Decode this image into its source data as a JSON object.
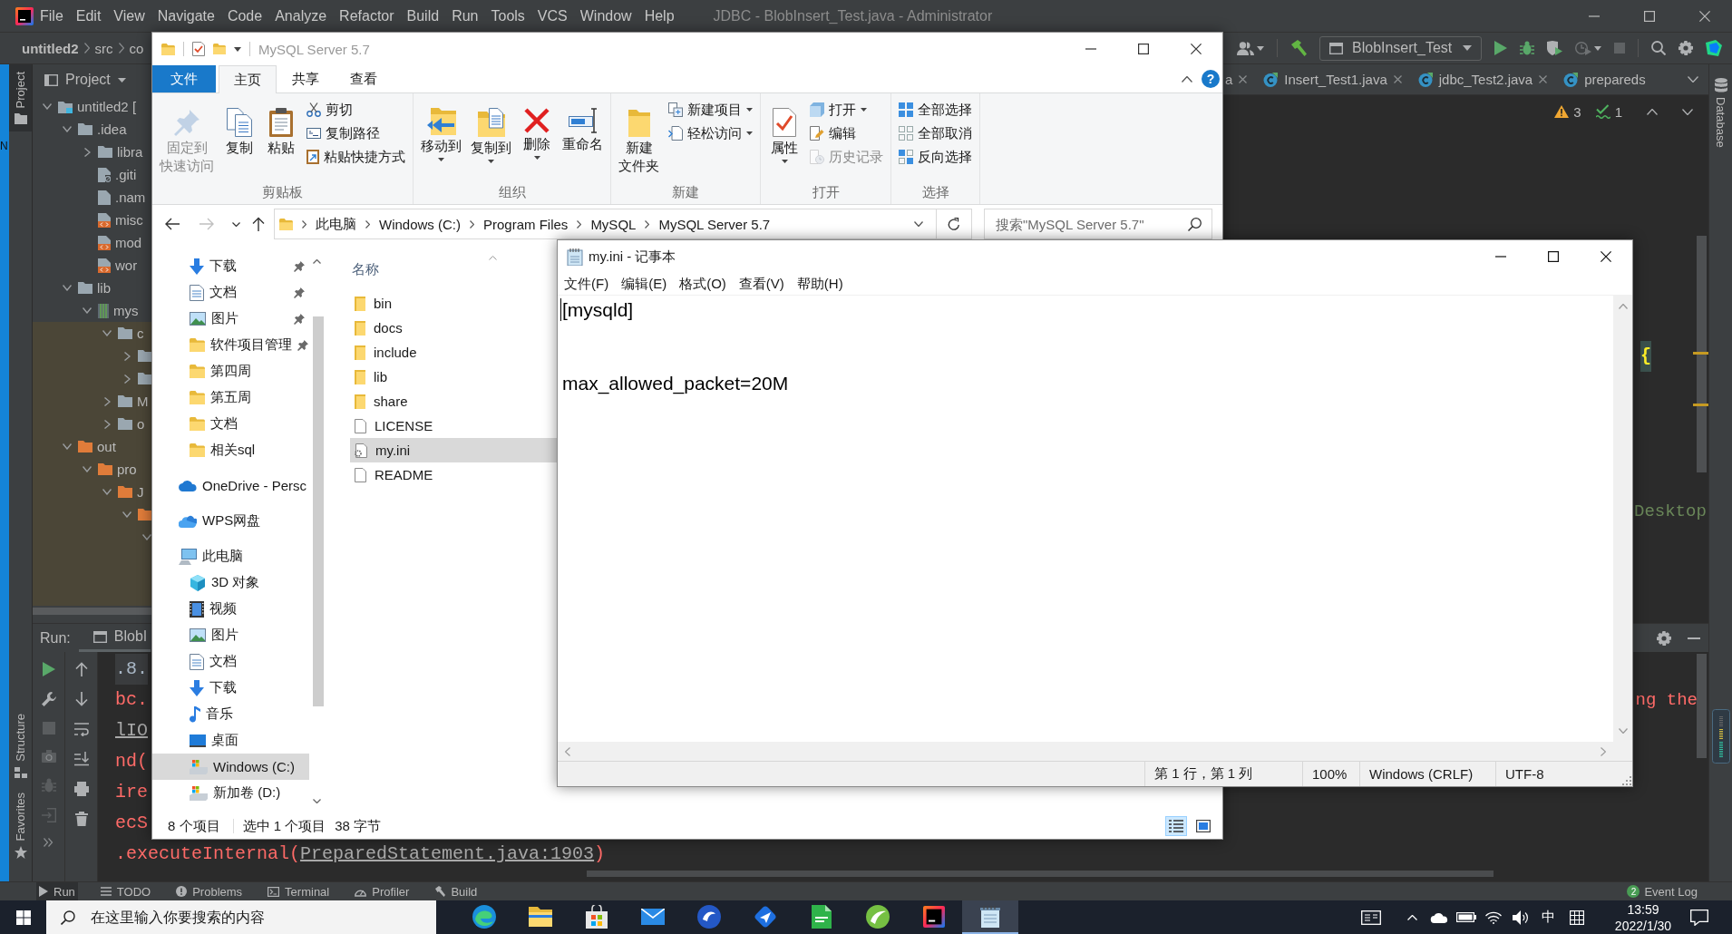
{
  "desktop": {
    "edge_text": "N"
  },
  "ide": {
    "menu": [
      "File",
      "Edit",
      "View",
      "Navigate",
      "Code",
      "Analyze",
      "Refactor",
      "Build",
      "Run",
      "Tools",
      "VCS",
      "Window",
      "Help"
    ],
    "title": "JDBC - BlobInsert_Test.java - Administrator",
    "breadcrumb": [
      "untitled2",
      "src",
      "co"
    ],
    "run_config": "BlobInsert_Test",
    "left_tool_tabs": [
      {
        "label": "Project",
        "selected": true
      },
      {
        "label": "Structure",
        "selected": false
      },
      {
        "label": "Favorites",
        "selected": false
      }
    ],
    "project_panel": {
      "title": "Project",
      "tree": [
        {
          "label": "untitled2 [",
          "kind": "module",
          "expanded": true,
          "tinted": false,
          "children": [
            {
              "label": ".idea",
              "kind": "folder",
              "expanded": true,
              "tinted": false,
              "children": [
                {
                  "label": "libra",
                  "kind": "folder",
                  "expanded": false,
                  "tinted": false
                },
                {
                  "label": ".giti",
                  "kind": "ignore",
                  "tinted": false
                },
                {
                  "label": ".nam",
                  "kind": "text",
                  "tinted": false
                },
                {
                  "label": "misc",
                  "kind": "xml",
                  "tinted": false
                },
                {
                  "label": "mod",
                  "kind": "xml",
                  "tinted": false
                },
                {
                  "label": "wor",
                  "kind": "xml",
                  "tinted": false
                }
              ]
            },
            {
              "label": "lib",
              "kind": "folder",
              "expanded": true,
              "tinted": false,
              "children": [
                {
                  "label": "mys",
                  "kind": "jar",
                  "expanded": true,
                  "tinted": false,
                  "children": [
                    {
                      "label": "c",
                      "kind": "folder",
                      "expanded": true,
                      "tinted": true,
                      "children": [
                        {
                          "kind": "folder",
                          "expanded": false,
                          "tinted": true
                        },
                        {
                          "kind": "folder",
                          "expanded": false,
                          "tinted": true
                        }
                      ]
                    },
                    {
                      "label": "M",
                      "kind": "folder",
                      "expanded": false,
                      "tinted": true
                    },
                    {
                      "label": "o",
                      "kind": "folder",
                      "expanded": false,
                      "tinted": true
                    }
                  ]
                }
              ]
            },
            {
              "label": "out",
              "kind": "excluded",
              "expanded": true,
              "tinted": true,
              "children": [
                {
                  "label": "pro",
                  "kind": "excluded",
                  "expanded": true,
                  "tinted": true,
                  "children": [
                    {
                      "label": "J",
                      "kind": "excluded",
                      "expanded": true,
                      "tinted": true,
                      "children": [
                        {
                          "kind": "excluded",
                          "expanded": true,
                          "tinted": true,
                          "children": [
                            {
                              "expanded": true,
                              "tinted": true
                            }
                          ]
                        }
                      ]
                    }
                  ]
                }
              ]
            }
          ]
        }
      ]
    },
    "editor_tabs": [
      {
        "label": "a",
        "kind": "tail"
      },
      {
        "label": "Insert_Test1.java",
        "kind": "full"
      },
      {
        "label": "jdbc_Test2.java",
        "kind": "full"
      },
      {
        "label": "prepareds",
        "kind": "head"
      }
    ],
    "inspections": {
      "warnings": "3",
      "weak_warnings": "1"
    },
    "editor": {
      "brace": "{",
      "string_fragment": "Desktop"
    },
    "run_panel": {
      "label": "Run:",
      "tab": "BlobI",
      "lines": [
        {
          "text": ".8.",
          "kind": "highlight"
        },
        {
          "text": "bc.",
          "kind": "error",
          "tail": "ng the"
        },
        {
          "text": "lIO",
          "kind": "link"
        },
        {
          "text": "nd(",
          "kind": "error"
        },
        {
          "text": "ire",
          "kind": "error"
        },
        {
          "text": "ecS",
          "kind": "error"
        }
      ],
      "trace": {
        "prefix": ".executeInternal(",
        "link": "PreparedStatement.java:1903",
        "suffix": ")"
      }
    },
    "bottom_tools": [
      {
        "label": "Run",
        "selected": true
      },
      {
        "label": "TODO",
        "selected": false
      },
      {
        "label": "Problems",
        "selected": false
      },
      {
        "label": "Terminal",
        "selected": false
      },
      {
        "label": "Profiler",
        "selected": false
      },
      {
        "label": "Build",
        "selected": false
      }
    ],
    "event_log": {
      "count": "2",
      "label": "Event Log"
    },
    "right_tool_tabs": [
      "Database"
    ]
  },
  "explorer": {
    "title": "MySQL Server 5.7",
    "file_menu": "文件",
    "help": "?",
    "ribbon_tabs": [
      {
        "label": "主页",
        "selected": true
      },
      {
        "label": "共享",
        "selected": false
      },
      {
        "label": "查看",
        "selected": false
      }
    ],
    "ribbon_groups": [
      {
        "label": "剪贴板",
        "buttons": [
          {
            "kind": "large",
            "lines": [
              "固定到",
              "快速访问"
            ],
            "disabled": true,
            "dropdown": false
          },
          {
            "kind": "large",
            "lines": [
              "复制"
            ],
            "disabled": false,
            "dropdown": false
          },
          {
            "kind": "large",
            "lines": [
              "粘贴"
            ],
            "disabled": false,
            "dropdown": false
          },
          {
            "kind": "small",
            "lines": [
              "剪切"
            ],
            "disabled": false,
            "dropdown": false
          },
          {
            "kind": "small",
            "lines": [
              "复制路径"
            ],
            "disabled": false,
            "dropdown": false
          },
          {
            "kind": "small",
            "lines": [
              "粘贴快捷方式"
            ],
            "disabled": false,
            "dropdown": false
          }
        ]
      },
      {
        "label": "组织",
        "buttons": [
          {
            "kind": "large",
            "lines": [
              "移动到"
            ],
            "disabled": false,
            "dropdown": true
          },
          {
            "kind": "large",
            "lines": [
              "复制到"
            ],
            "disabled": false,
            "dropdown": true
          },
          {
            "kind": "large",
            "lines": [
              "删除"
            ],
            "disabled": false,
            "dropdown": true
          },
          {
            "kind": "large",
            "lines": [
              "重命名"
            ],
            "disabled": false,
            "dropdown": false
          }
        ]
      },
      {
        "label": "新建",
        "buttons": [
          {
            "kind": "large",
            "lines": [
              "新建",
              "文件夹"
            ],
            "disabled": false,
            "dropdown": false
          },
          {
            "kind": "small",
            "lines": [
              "新建项目"
            ],
            "disabled": false,
            "dropdown": true
          },
          {
            "kind": "small",
            "lines": [
              "轻松访问"
            ],
            "disabled": false,
            "dropdown": true
          }
        ]
      },
      {
        "label": "打开",
        "buttons": [
          {
            "kind": "large",
            "lines": [
              "属性"
            ],
            "disabled": false,
            "dropdown": true
          },
          {
            "kind": "small",
            "lines": [
              "打开"
            ],
            "disabled": false,
            "dropdown": true
          },
          {
            "kind": "small",
            "lines": [
              "编辑"
            ],
            "disabled": false,
            "dropdown": false
          },
          {
            "kind": "small",
            "lines": [
              "历史记录"
            ],
            "disabled": true,
            "dropdown": false
          }
        ]
      },
      {
        "label": "选择",
        "buttons": [
          {
            "kind": "small",
            "lines": [
              "全部选择"
            ],
            "disabled": false,
            "dropdown": false
          },
          {
            "kind": "small",
            "lines": [
              "全部取消"
            ],
            "disabled": false,
            "dropdown": false
          },
          {
            "kind": "small",
            "lines": [
              "反向选择"
            ],
            "disabled": false,
            "dropdown": false
          }
        ]
      }
    ],
    "nav_buttons": [
      {
        "disabled": false
      },
      {
        "disabled": true
      },
      {
        "disabled": false
      },
      {
        "disabled": false
      }
    ],
    "address": [
      "此电脑",
      "Windows (C:)",
      "Program Files",
      "MySQL",
      "MySQL Server 5.7"
    ],
    "search_placeholder": "搜索\"MySQL Server 5.7\"",
    "nav_pane": {
      "quick_access": [
        {
          "label": "下载",
          "kind": "downloads",
          "pinned": true,
          "selected": false
        },
        {
          "label": "文档",
          "kind": "documents",
          "pinned": true,
          "selected": false
        },
        {
          "label": "图片",
          "kind": "pictures",
          "pinned": true,
          "selected": false
        },
        {
          "label": "软件项目管理",
          "kind": "folder",
          "pinned": true,
          "selected": false
        },
        {
          "label": "第四周",
          "kind": "folder",
          "pinned": false,
          "selected": false
        },
        {
          "label": "第五周",
          "kind": "folder",
          "pinned": false,
          "selected": false
        },
        {
          "label": "文档",
          "kind": "folder",
          "pinned": false,
          "selected": false
        },
        {
          "label": "相关sql",
          "kind": "folder",
          "pinned": false,
          "selected": false
        }
      ],
      "locations": [
        {
          "label": "OneDrive - Persc",
          "kind": "onedrive",
          "selected": false
        },
        {
          "label": "WPS网盘",
          "kind": "cloud",
          "selected": false
        },
        {
          "label": "此电脑",
          "kind": "computer",
          "selected": false,
          "children": [
            {
              "label": "3D 对象",
              "kind": "objects3d",
              "selected": false
            },
            {
              "label": "视频",
              "kind": "videos",
              "selected": false
            },
            {
              "label": "图片",
              "kind": "pictures",
              "selected": false
            },
            {
              "label": "文档",
              "kind": "documents",
              "selected": false
            },
            {
              "label": "下载",
              "kind": "downloads",
              "selected": false
            },
            {
              "label": "音乐",
              "kind": "music",
              "selected": false
            },
            {
              "label": "桌面",
              "kind": "desktop",
              "selected": false
            },
            {
              "label": "Windows (C:)",
              "kind": "drive",
              "selected": true
            },
            {
              "label": "新加卷 (D:)",
              "kind": "drive",
              "selected": false
            }
          ]
        }
      ]
    },
    "file_list": {
      "column": "名称",
      "rows": [
        {
          "name": "bin",
          "kind": "folder",
          "selected": false
        },
        {
          "name": "docs",
          "kind": "folder",
          "selected": false
        },
        {
          "name": "include",
          "kind": "folder",
          "selected": false
        },
        {
          "name": "lib",
          "kind": "folder",
          "selected": false
        },
        {
          "name": "share",
          "kind": "folder",
          "selected": false
        },
        {
          "name": "LICENSE",
          "kind": "file",
          "selected": false
        },
        {
          "name": "my.ini",
          "kind": "settings",
          "selected": true
        },
        {
          "name": "README",
          "kind": "file",
          "selected": false
        }
      ]
    },
    "status": {
      "count": "8 个项目",
      "selection": "选中 1 个项目",
      "size": "38 字节"
    },
    "view_modes": [
      {
        "selected": true
      },
      {
        "selected": false
      }
    ]
  },
  "notepad": {
    "title": "my.ini - 记事本",
    "menu": [
      "文件(F)",
      "编辑(E)",
      "格式(O)",
      "查看(V)",
      "帮助(H)"
    ],
    "content": "[mysqld]\n\n\nmax_allowed_packet=20M",
    "status": {
      "position": "第 1 行，第 1 列",
      "zoom": "100%",
      "line_ending": "Windows (CRLF)",
      "encoding": "UTF-8"
    }
  },
  "taskbar": {
    "search_placeholder": "在这里输入你要搜索的内容",
    "apps": [
      {
        "selected": false
      },
      {
        "selected": false
      },
      {
        "selected": false
      },
      {
        "selected": false
      },
      {
        "selected": false
      },
      {
        "selected": false
      },
      {
        "selected": false
      },
      {
        "selected": false
      },
      {
        "selected": false
      },
      {
        "selected": true
      }
    ],
    "ime": "中",
    "time": "13:59",
    "date": "2022/1/30"
  }
}
